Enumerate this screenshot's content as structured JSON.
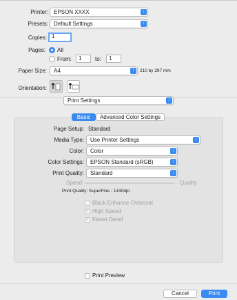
{
  "printer": {
    "label": "Printer:",
    "value": "EPSON XXXX"
  },
  "presets": {
    "label": "Presets:",
    "value": "Default Settings"
  },
  "copies": {
    "label": "Copies:",
    "value": "1"
  },
  "pages": {
    "label": "Pages:",
    "all_label": "All",
    "from_label": "From:",
    "from_value": "1",
    "to_label": "to:",
    "to_value": "1",
    "selected": "All"
  },
  "paper_size": {
    "label": "Paper Size:",
    "value": "A4",
    "dimensions": "210 by 297 mm"
  },
  "orientation": {
    "label": "Orientation:",
    "selected": "portrait",
    "options": [
      "portrait",
      "landscape"
    ]
  },
  "section_popup": {
    "value": "Print Settings"
  },
  "tabs": [
    {
      "label": "Basic",
      "selected": true
    },
    {
      "label": "Advanced Color Settings",
      "selected": false
    }
  ],
  "settings": {
    "page_setup": {
      "label": "Page Setup:",
      "value": "Standard"
    },
    "media_type": {
      "label": "Media Type:",
      "value": "Use Printer Settings"
    },
    "color": {
      "label": "Color:",
      "value": "Color"
    },
    "color_settings": {
      "label": "Color Settings:",
      "value": "EPSON Standard (sRGB)"
    },
    "print_quality": {
      "label": "Print Quality:",
      "value": "Standard"
    }
  },
  "quality_slider": {
    "left_label": "Speed",
    "right_label": "Quality",
    "level": 0
  },
  "quality_readout": "Print Quality: SuperFine - 1440dpi",
  "options": [
    {
      "label": "Black Enhance Overcoat",
      "checked": false
    },
    {
      "label": "High Speed",
      "checked": true
    },
    {
      "label": "Finest Detail",
      "checked": true
    }
  ],
  "print_preview": {
    "label": "Print Preview",
    "checked": false
  },
  "buttons": {
    "cancel": "Cancel",
    "print": "Print"
  },
  "colors": {
    "accent": "#3a8af0",
    "background": "#ececec"
  }
}
